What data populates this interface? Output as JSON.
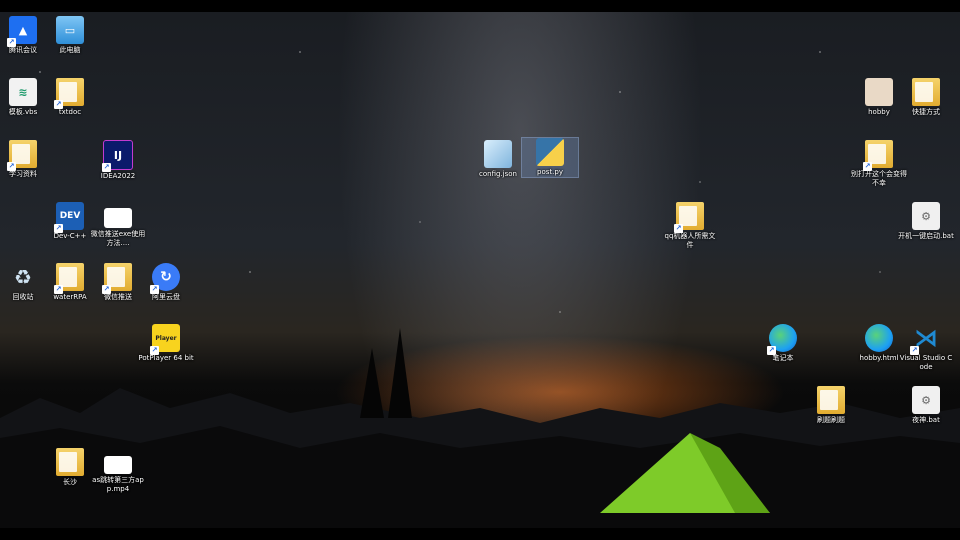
{
  "desktop": {
    "icons": [
      {
        "label": "腾讯会议",
        "icon": "tencent-meeting-icon"
      },
      {
        "label": "此电脑",
        "icon": "computer-icon"
      },
      {
        "label": "模板.vbs",
        "icon": "vbs-script-icon"
      },
      {
        "label": "txtdoc",
        "icon": "folder-icon"
      },
      {
        "label": "学习资料",
        "icon": "folder-icon"
      },
      {
        "label": "IDEA2022",
        "icon": "intellij-idea-icon"
      },
      {
        "label": "DEV",
        "icon": "dev-cpp-icon"
      },
      {
        "label": "Dev-C++",
        "icon": "dev-cpp-icon"
      },
      {
        "label": "微信推送exe使用方法....",
        "icon": "video-file-icon"
      },
      {
        "label": "回收站",
        "icon": "recycle-bin-icon"
      },
      {
        "label": "waterRPA",
        "icon": "folder-icon"
      },
      {
        "label": "微信推送",
        "icon": "folder-icon"
      },
      {
        "label": "阿里云盘",
        "icon": "aliyun-drive-icon"
      },
      {
        "label": "PotPlayer 64 bit",
        "icon": "potplayer-icon"
      },
      {
        "label": "长沙",
        "icon": "folder-icon"
      },
      {
        "label": "as跳转第三方app.mp4",
        "icon": "video-file-icon"
      },
      {
        "label": "config.json",
        "icon": "json-file-icon"
      },
      {
        "label": "post.py",
        "icon": "python-file-icon"
      },
      {
        "label": "qq机器人所需文件",
        "icon": "folder-icon"
      },
      {
        "label": "hobby",
        "icon": "image-icon"
      },
      {
        "label": "快捷方式",
        "icon": "folder-icon"
      },
      {
        "label": "别打开这个会变得不幸",
        "icon": "folder-icon"
      },
      {
        "label": "开机一键启动.bat",
        "icon": "bat-file-icon"
      },
      {
        "label": "笔记本",
        "icon": "edge-icon"
      },
      {
        "label": "hobby.html",
        "icon": "edge-icon"
      },
      {
        "label": "Visual Studio Code",
        "icon": "vscode-icon"
      },
      {
        "label": "刷题刷题",
        "icon": "folder-icon"
      },
      {
        "label": "夜神.bat",
        "icon": "bat-file-icon"
      }
    ],
    "glyph_text": {
      "idea": "IJ",
      "dev": "DEV",
      "potplayer": "Player"
    },
    "colors": {
      "tencent": "#1e6ff1",
      "idea": "#0b1a6b",
      "dev": "#1c5fb5",
      "aliyun": "#3a7bf7",
      "potplayer": "#f8d31e",
      "edge": "#1da1f2",
      "vscode": "#1f8ad2",
      "tent": "#8be02c"
    }
  }
}
